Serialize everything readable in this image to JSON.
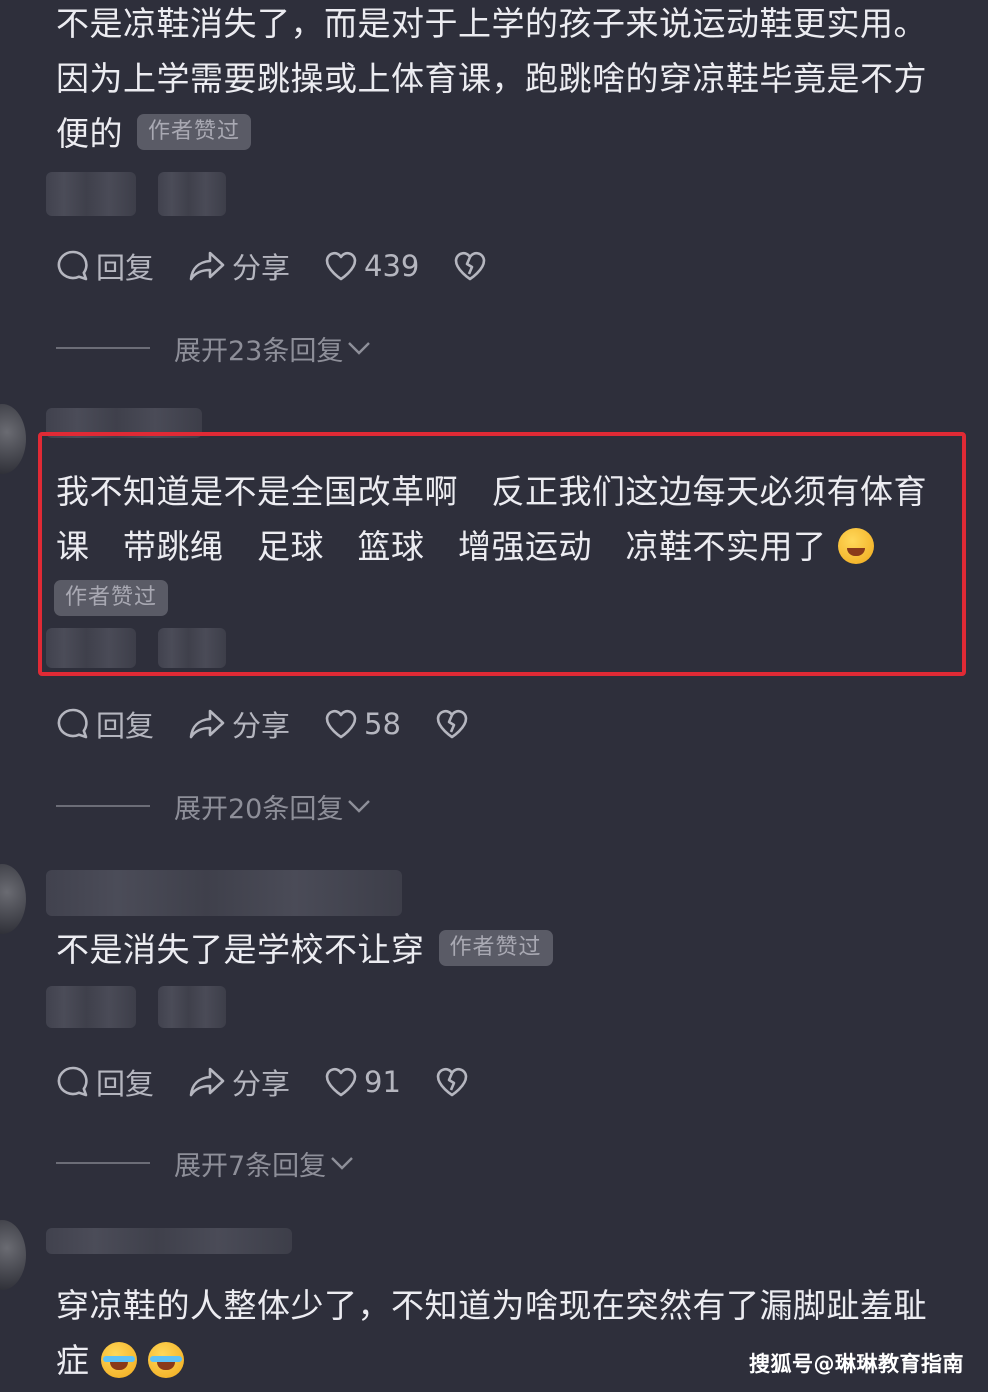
{
  "comments": [
    {
      "text": "不是凉鞋消失了，而是对于上学的孩子来说运动鞋更实用。因为上学需要跳操或上体育课，跑跳啥的穿凉鞋毕竟是不方便的",
      "badge": "作者赞过",
      "reply_label": "回复",
      "share_label": "分享",
      "likes": "439",
      "expand_label": "展开23条回复"
    },
    {
      "text": "我不知道是不是全国改革啊　反正我们这边每天必须有体育课　带跳绳　足球　篮球　增强运动　凉鞋不实用了",
      "badge": "作者赞过",
      "reply_label": "回复",
      "share_label": "分享",
      "likes": "58",
      "expand_label": "展开20条回复"
    },
    {
      "text": "不是消失了是学校不让穿",
      "badge": "作者赞过",
      "reply_label": "回复",
      "share_label": "分享",
      "likes": "91",
      "expand_label": "展开7条回复"
    },
    {
      "text": "穿凉鞋的人整体少了，不知道为啥现在突然有了漏脚趾羞耻症"
    }
  ],
  "colors": {
    "highlight": "#e02a35",
    "background": "#2e2f3b"
  },
  "watermark": "搜狐号@琳琳教育指南"
}
